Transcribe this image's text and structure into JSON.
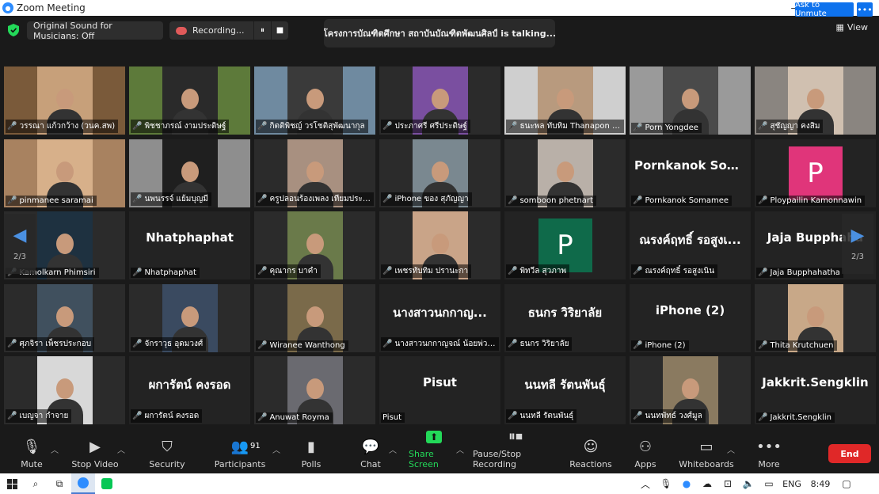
{
  "window": {
    "title": "Zoom Meeting",
    "controls": {
      "minimize": "—",
      "maximize": "❐",
      "close": "✕"
    }
  },
  "header": {
    "sound_label": "Original Sound for Musicians: Off",
    "recording_label": "Recording...",
    "pause_icon": "⏸",
    "stop_icon": "■",
    "talking": "โครงการบัณฑิตศึกษา สถาบันบัณฑิตพัฒนศิลป์ is talking...",
    "view_label": "View"
  },
  "gallery": {
    "ask_to_unmute": "Ask to Unmute",
    "more": "•••",
    "page_indicator": "2/3",
    "tiles": [
      {
        "name": "วรรณา แก้วกว้าง (วนค.สพ)",
        "bg": "#7a5a3a",
        "cam": "#c7a07a"
      },
      {
        "name": "พิชชาภรณ์ งามประดิษฐ์",
        "bg": "#5d7a3a",
        "cam": "#2a2a2a"
      },
      {
        "name": "กิตติพิชญ์ วรโชติสุพัฒนากุล",
        "bg": "#6f8aa0",
        "cam": "#3a3a3a"
      },
      {
        "name": "ประภาศรี ศรีประดิษฐ์",
        "bg": "#2b2b2b",
        "cam": "#7a4fa0"
      },
      {
        "name": "ธนะพล ทับทิม Thanapon thubthim",
        "bg": "#cfcfcf",
        "cam": "#b89a7e"
      },
      {
        "name": "Porn Yongdee",
        "bg": "#9a9a9a",
        "cam": "#4a4a4a"
      },
      {
        "name": "สุชัญญา คงสิม",
        "bg": "#8a8580",
        "cam": "#d0c0b0"
      },
      {
        "name": "pinmanee saramai",
        "bg": "#a88260",
        "cam": "#d7b08a"
      },
      {
        "name": "นพนรรจ์ แย้มบุญมี",
        "bg": "#8e8e8e",
        "cam": "#1f1f1f"
      },
      {
        "name": "ครูปลอนร้องเพลง เทียมประเสริฐ",
        "bg": "#2b2b2b",
        "cam": "#a89080"
      },
      {
        "name": "iPhone ของ สุภัญญา",
        "bg": "#2b2b2b",
        "cam": "#7a8890"
      },
      {
        "name": "somboon phetnart",
        "bg": "#2b2b2b",
        "cam": "#b9b0a8"
      },
      {
        "name": "Pornkanok Somamee",
        "big": "Pornkanok  Som..."
      },
      {
        "name": "Ploypailin Kamonnawin",
        "avatar": "P",
        "avatar_color": "#e0357a"
      },
      {
        "name": "Kamolkarn Phimsiri",
        "bg": "#2b2b2b",
        "cam": "#1e3140"
      },
      {
        "name": "Nhatphaphat",
        "big": "Nhatphaphat"
      },
      {
        "name": "คุณากร บาคำ",
        "bg": "#2b2b2b",
        "cam": "#6a7a4a"
      },
      {
        "name": "เพชรทับทิม ปรานะกา",
        "bg": "#2b2b2b",
        "cam": "#c9a488"
      },
      {
        "name": "พิทวีล สุวภาพ",
        "avatar": "P",
        "avatar_color": "#0f6a4a"
      },
      {
        "name": "ณรงค์ฤทธิ์ รอสูงเนิน",
        "big": "ณรงค์ฤทธิ์  รอสูงเ..."
      },
      {
        "name": "Jaja Bupphahatha",
        "big": "Jaja  Bupphaha"
      },
      {
        "name": "ศุภจิรา เพ็ชรประกอบ",
        "bg": "#2b2b2b",
        "cam": "#40505e"
      },
      {
        "name": "จักราวุธ อุดมวงศ์",
        "bg": "#2b2b2b",
        "cam": "#3a4a60"
      },
      {
        "name": "Wiranee Wanthong",
        "bg": "#2b2b2b",
        "cam": "#7a6a4a"
      },
      {
        "name": "นางสาวนกกาญจณ์ น้อยพ่วงค่อ",
        "big": "นางสาวนกกาญ..."
      },
      {
        "name": "ธนกร วิริยาลัย",
        "big": "ธนกร  วิริยาลัย"
      },
      {
        "name": "iPhone (2)",
        "big": "iPhone  (2)"
      },
      {
        "name": "Thita Krutchuen",
        "bg": "#2b2b2b",
        "cam": "#c8a888"
      },
      {
        "name": "เบญจา กำจาย",
        "bg": "#2b2b2b",
        "cam": "#d8d8d8"
      },
      {
        "name": "ผการัตน์ คงรอด",
        "big": "ผการัตน์  คงรอด"
      },
      {
        "name": "Anuwat Royma",
        "bg": "#2b2b2b",
        "cam": "#6a6a70"
      },
      {
        "name": "Pisut",
        "big": "Pisut",
        "no_mic": true
      },
      {
        "name": "นนทลี รัตนพันธุ์",
        "big": "นนทลี  รัตนพันธุ์"
      },
      {
        "name": "นนทพัทธ์ วงศ์มูล",
        "bg": "#2b2b2b",
        "cam": "#8a7a60"
      },
      {
        "name": "Jakkrit.Sengklin",
        "big": "Jakkrit.Sengklin"
      }
    ]
  },
  "toolbar": {
    "mute": "Mute",
    "stop_video": "Stop Video",
    "security": "Security",
    "participants": "Participants",
    "participants_count": "91",
    "polls": "Polls",
    "chat": "Chat",
    "share_screen": "Share Screen",
    "pause_stop_recording": "Pause/Stop Recording",
    "reactions": "Reactions",
    "apps": "Apps",
    "whiteboards": "Whiteboards",
    "more": "More",
    "end": "End"
  },
  "taskbar": {
    "language": "ENG",
    "time": "8:49"
  },
  "colors": {
    "accent_blue": "#0e72ed",
    "share_green": "#23d959",
    "end_red": "#e02828",
    "muted_red": "#e74c3c"
  }
}
